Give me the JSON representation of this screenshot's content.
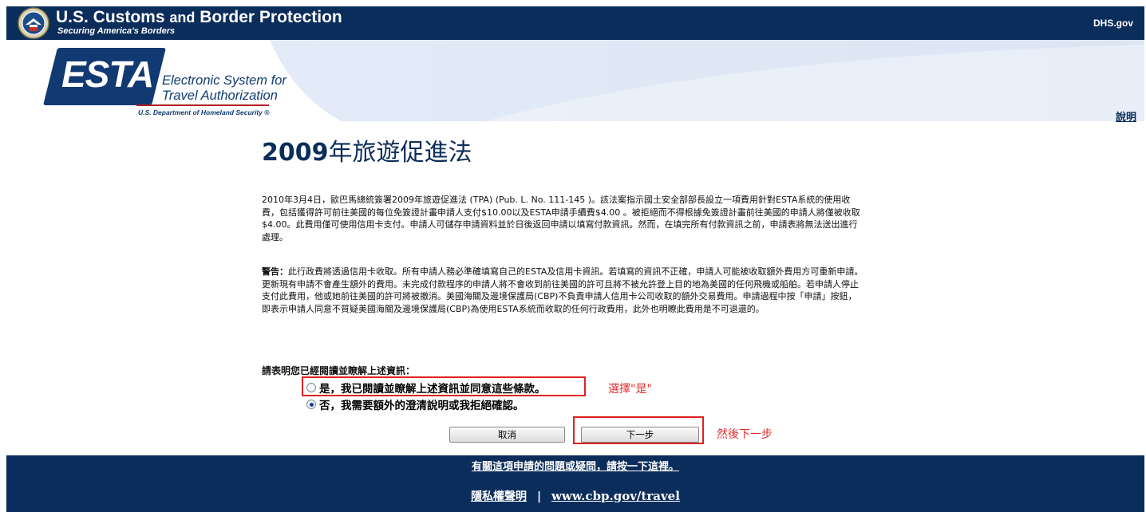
{
  "header": {
    "agency_title_1": "U.S. Customs",
    "agency_title_and": "and",
    "agency_title_2": "Border Protection",
    "tagline": "Securing America's Borders",
    "dhs_link": "DHS.gov",
    "brand_color": "#0b2d5b"
  },
  "esta_logo": {
    "mark": "ESTA",
    "line1": "Electronic System for",
    "line2": "Travel Authorization",
    "dept": "U.S. Department of Homeland Security",
    "dept_mark": "®"
  },
  "help_link": "說明",
  "main": {
    "title_year": "2009",
    "title_text": "年旅遊促進法",
    "paragraph1": "2010年3月4日，歐巴馬總統簽署2009年旅遊促進法 (TPA) (Pub. L. No. 111-145 )。該法案指示國土安全部部長設立一項費用針對ESTA系統的使用收費，包括獲得許可前往美國的每位免簽證計畫申請人支付$10.00以及ESTA申請手續費$4.00 。被拒絕而不得根據免簽證計畫前往美國的申請人將僅被收取$4.00。此費用僅可使用信用卡支付。申請人可儲存申請資料並於日後返回申請以填寫付款資訊。然而，在填完所有付款資訊之前，申請表將無法送出進行處理。",
    "warning_label": "警告：",
    "paragraph2": "此行政費將透過信用卡收取。所有申請人務必準確填寫自己的ESTA及信用卡資訊。若填寫的資訊不正確，申請人可能被收取額外費用方可重新申請。更新現有申請不會產生額外的費用。未完成付款程序的申請人將不會收到前往美國的許可且將不被允許登上目的地為美國的任何飛機或船舶。若申請人停止支付此費用，他或她前往美國的許可將被撤消。美國海關及邊境保護局(CBP)不負責申請人信用卡公司收取的額外交易費用。申請過程中按「申請」按鈕，即表示申請人同意不質疑美國海關及邊境保護局(CBP)為使用ESTA系統而收取的任何行政費用，此外也明瞭此費用是不可退還的。",
    "question": "請表明您已經閱讀並瞭解上述資訊：",
    "option_yes": "是，我已閱讀並瞭解上述資訊並同意這些條款。",
    "option_no": "否，我需要額外的澄清說明或我拒絕確認。",
    "selected_option": "no",
    "annotation_yes": "選擇\"是\"",
    "annotation_next": "然後下一步",
    "annotation_color": "#e02020",
    "cancel_button": "取消",
    "next_button": "下一步"
  },
  "footer": {
    "question_link": "有關這項申請的問題或疑問，請按一下這裡。",
    "privacy_link": "隱私權聲明",
    "separator": "|",
    "cbp_link": "www.cbp.gov/travel"
  }
}
